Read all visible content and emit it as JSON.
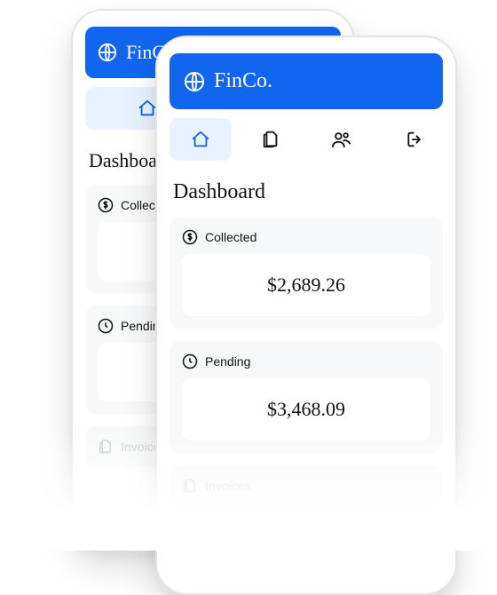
{
  "brand": "FinCo.",
  "page_title": "Dashboard",
  "nav": {
    "items": [
      "home",
      "document",
      "users",
      "logout"
    ]
  },
  "cards": {
    "collected": {
      "label": "Collected",
      "value": "$2,689.26"
    },
    "pending": {
      "label": "Pending",
      "value": "$3,468.09"
    },
    "invoices": {
      "label": "Invoices"
    }
  }
}
